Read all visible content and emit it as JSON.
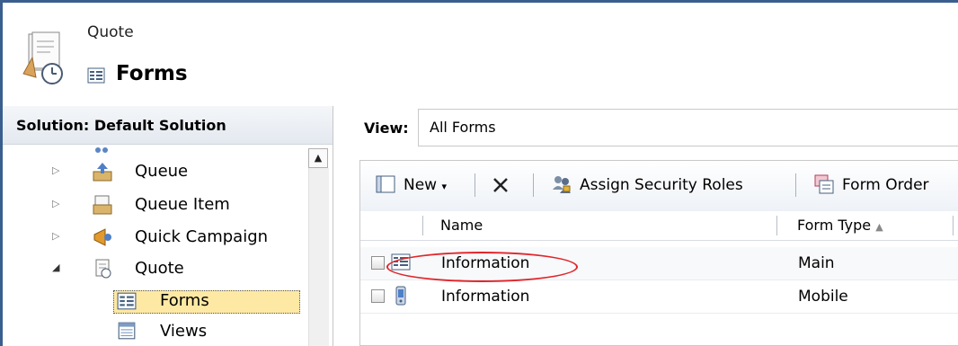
{
  "header": {
    "entity": "Quote",
    "title": "Forms"
  },
  "nav": {
    "solution_label": "Solution: Default Solution",
    "items": [
      {
        "label": "Queue",
        "icon": "queue-icon",
        "expanded": false
      },
      {
        "label": "Queue Item",
        "icon": "queue-item-icon",
        "expanded": false
      },
      {
        "label": "Quick Campaign",
        "icon": "quick-campaign-icon",
        "expanded": false
      },
      {
        "label": "Quote",
        "icon": "quote-icon",
        "expanded": true
      },
      {
        "label": "Forms",
        "icon": "forms-icon",
        "selected": true
      },
      {
        "label": "Views",
        "icon": "views-icon"
      }
    ]
  },
  "view": {
    "label": "View:",
    "value": "All Forms"
  },
  "toolbar": {
    "new_label": "New",
    "assign_roles_label": "Assign Security Roles",
    "form_order_label": "Form Order"
  },
  "grid": {
    "columns": [
      "Name",
      "Form Type"
    ],
    "sort_indicator": "▲",
    "rows": [
      {
        "name": "Information",
        "type": "Main",
        "icon": "form-main-icon"
      },
      {
        "name": "Information",
        "type": "Mobile",
        "icon": "mobile-form-icon"
      }
    ]
  },
  "colors": {
    "frame_border": "#3a5f8f",
    "selected_bg": "#fde9a4",
    "annotation": "#e0262b"
  }
}
